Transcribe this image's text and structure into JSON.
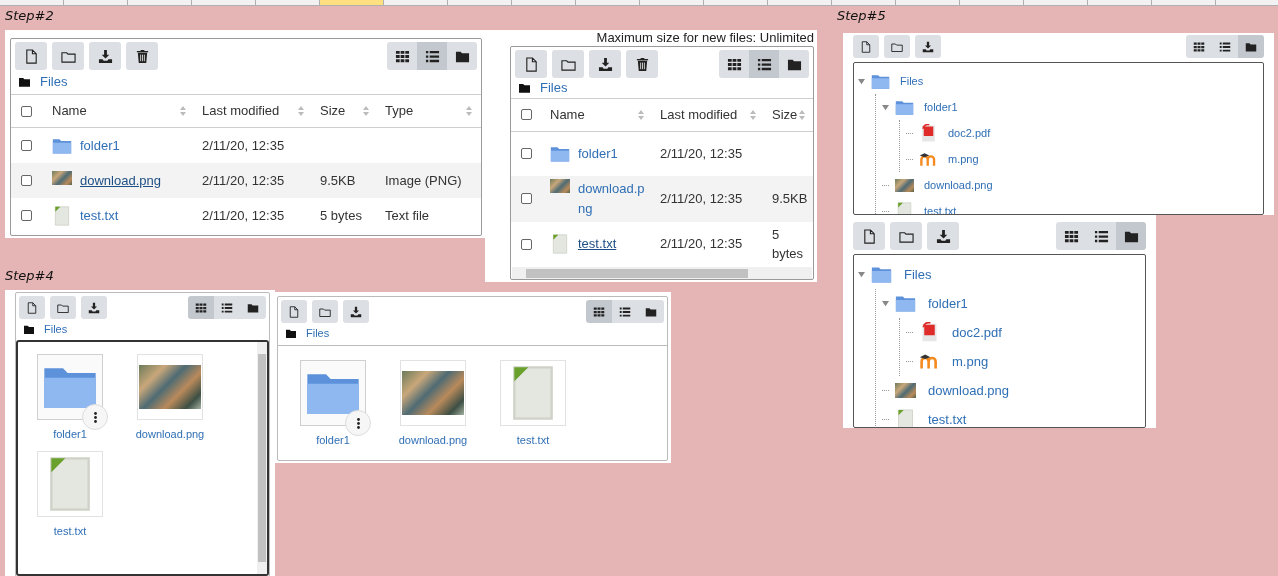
{
  "sheet": {
    "header_cells": [
      {
        "selected": false
      },
      {
        "selected": false
      },
      {
        "selected": false
      },
      {
        "selected": false
      },
      {
        "selected": false
      },
      {
        "selected": true
      },
      {
        "selected": false
      },
      {
        "selected": false
      },
      {
        "selected": false
      },
      {
        "selected": false
      },
      {
        "selected": false
      },
      {
        "selected": false
      },
      {
        "selected": false
      },
      {
        "selected": false
      },
      {
        "selected": false
      },
      {
        "selected": false
      },
      {
        "selected": false
      },
      {
        "selected": false
      },
      {
        "selected": false
      },
      {
        "selected": false
      }
    ]
  },
  "panels": [
    {
      "kind": "table",
      "label": "Step#2",
      "can_delete": true,
      "views": [
        {
          "kind": "grid",
          "selected": false
        },
        {
          "kind": "list",
          "selected": true
        },
        {
          "kind": "tree",
          "selected": false
        }
      ],
      "path": "Files",
      "all_checked": false,
      "columns": [
        "Name",
        "Last modified",
        "Size",
        "Type"
      ],
      "rows": [
        {
          "name": "folder1",
          "kind": "folder",
          "checked": false,
          "hover": false,
          "modified": "2/11/20, 12:35",
          "size": "",
          "type": ""
        },
        {
          "name": "download.png",
          "kind": "image",
          "checked": false,
          "hover": true,
          "modified": "2/11/20, 12:35",
          "size": "9.5KB",
          "type": "Image (PNG)"
        },
        {
          "name": "test.txt",
          "kind": "text",
          "checked": false,
          "hover": false,
          "modified": "2/11/20, 12:35",
          "size": "5 bytes",
          "type": "Text file"
        }
      ]
    },
    {
      "kind": "table",
      "max_size": "Maximum size for new files: Unlimited",
      "can_delete": true,
      "views": [
        {
          "kind": "grid",
          "selected": false
        },
        {
          "kind": "list",
          "selected": true
        },
        {
          "kind": "tree",
          "selected": false
        }
      ],
      "path": "Files",
      "all_checked": false,
      "columns": [
        "Name",
        "Last modified",
        "Size"
      ],
      "rows": [
        {
          "name": "folder1",
          "kind": "folder",
          "checked": false,
          "hover": false,
          "modified": "2/11/20, 12:35",
          "size": ""
        },
        {
          "name": "download.png",
          "kind": "image",
          "checked": false,
          "hover": false,
          "modified": "2/11/20, 12:35",
          "size": "9.5KB"
        },
        {
          "name": "test.txt",
          "kind": "text",
          "checked": false,
          "hover": true,
          "modified": "2/11/20, 12:35",
          "size": "5 bytes"
        }
      ]
    },
    {
      "kind": "tree",
      "label": "Step#5",
      "can_delete": false,
      "views": [
        {
          "kind": "grid",
          "selected": false
        },
        {
          "kind": "list",
          "selected": false
        },
        {
          "kind": "tree",
          "selected": true
        }
      ],
      "tree": [
        {
          "name": "Files",
          "kind": "folder",
          "expanded": true,
          "children": [
            {
              "name": "folder1",
              "kind": "folder",
              "expanded": true,
              "children": [
                {
                  "name": "doc2.pdf",
                  "kind": "pdf"
                },
                {
                  "name": "m.png",
                  "kind": "logo"
                }
              ]
            },
            {
              "name": "download.png",
              "kind": "image"
            },
            {
              "name": "test.txt",
              "kind": "text"
            }
          ]
        }
      ]
    },
    {
      "kind": "grid",
      "label": "Step#4",
      "can_delete": false,
      "views": [
        {
          "kind": "grid",
          "selected": true
        },
        {
          "kind": "list",
          "selected": false
        },
        {
          "kind": "tree",
          "selected": false
        }
      ],
      "path": "Files",
      "items": [
        {
          "name": "folder1",
          "kind": "folder",
          "hover": true
        },
        {
          "name": "download.png",
          "kind": "image",
          "hover": false
        },
        {
          "name": "test.txt",
          "kind": "text",
          "hover": false
        }
      ]
    },
    {
      "kind": "grid",
      "can_delete": false,
      "views": [
        {
          "kind": "grid",
          "selected": true
        },
        {
          "kind": "list",
          "selected": false
        },
        {
          "kind": "tree",
          "selected": false
        }
      ],
      "path": "Files",
      "items": [
        {
          "name": "folder1",
          "kind": "folder",
          "hover": true
        },
        {
          "name": "download.png",
          "kind": "image",
          "hover": false
        },
        {
          "name": "test.txt",
          "kind": "text",
          "hover": false
        }
      ]
    },
    {
      "kind": "tree",
      "can_delete": false,
      "views": [
        {
          "kind": "grid",
          "selected": false
        },
        {
          "kind": "list",
          "selected": false
        },
        {
          "kind": "tree",
          "selected": true
        }
      ],
      "tree": [
        {
          "name": "Files",
          "kind": "folder",
          "expanded": true,
          "children": [
            {
              "name": "folder1",
              "kind": "folder",
              "expanded": true,
              "children": [
                {
                  "name": "doc2.pdf",
                  "kind": "pdf"
                },
                {
                  "name": "m.png",
                  "kind": "logo"
                }
              ]
            },
            {
              "name": "download.png",
              "kind": "image"
            },
            {
              "name": "test.txt",
              "kind": "text"
            }
          ]
        }
      ]
    }
  ]
}
